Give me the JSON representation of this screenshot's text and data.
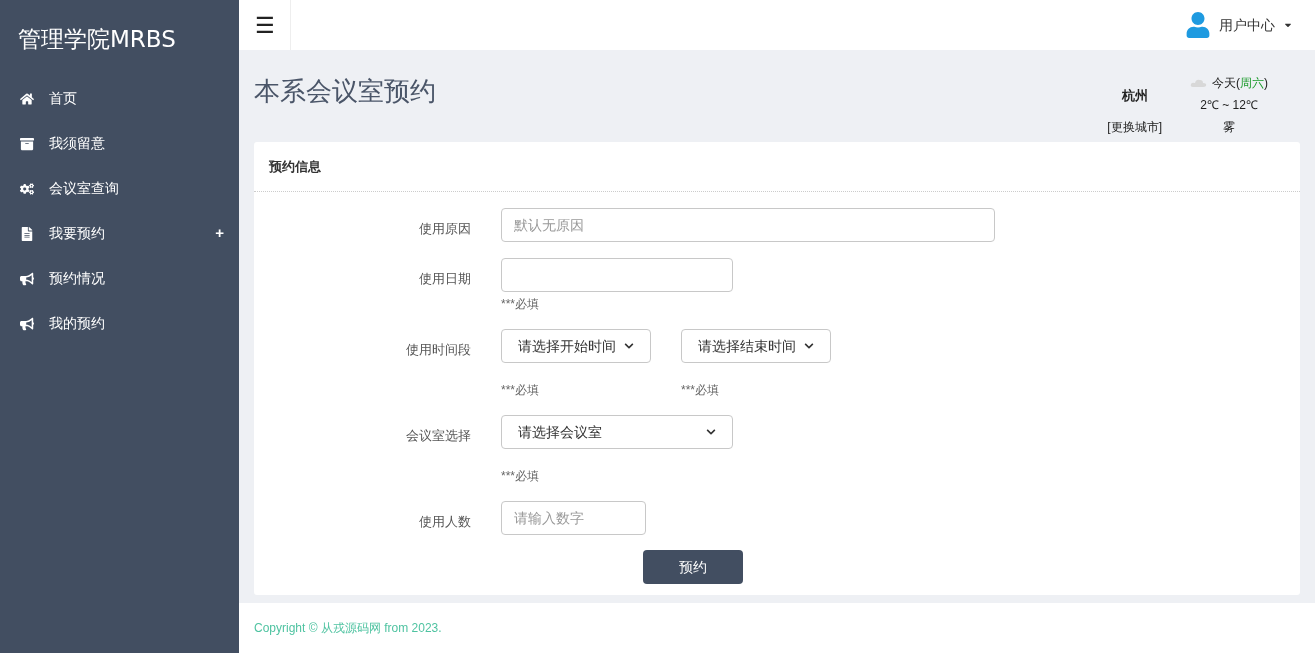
{
  "sidebar": {
    "title": "管理学院MRBS",
    "items": [
      {
        "label": "首页",
        "kind": "link"
      },
      {
        "label": "我须留意",
        "kind": "link"
      },
      {
        "label": "会议室查询",
        "kind": "link"
      },
      {
        "label": "我要预约",
        "kind": "submenu",
        "toggle": "+"
      },
      {
        "label": "预约情况",
        "kind": "link"
      },
      {
        "label": "我的预约",
        "kind": "link"
      }
    ]
  },
  "topbar": {
    "menu_toggle": "☰",
    "user_menu": "用户中心"
  },
  "page_title": "本系会议室预约",
  "weather": {
    "city": "杭州",
    "change_city": "[更换城市]",
    "day": "今天(",
    "weekday": "周六",
    "day_close": ")",
    "temperature": "2℃ ~ 12℃",
    "condition": "雾"
  },
  "card": {
    "title": "预约信息",
    "rows": [
      {
        "label": "使用原因",
        "kind": "input",
        "placeholder": "默认无原因"
      },
      {
        "label": "使用日期",
        "kind": "input",
        "hint": "***必填"
      },
      {
        "label": "使用时间段",
        "kind": "select_pair",
        "fields": [
          {
            "value": "请选择开始时间",
            "hint": "***必填"
          },
          {
            "value": "请选择结束时间",
            "hint": "***必填"
          }
        ]
      },
      {
        "label": "会议室选择",
        "kind": "select",
        "value": "请选择会议室",
        "hint": "***必填"
      },
      {
        "label": "使用人数",
        "kind": "input",
        "placeholder": "请输入数字"
      }
    ],
    "submit": "预约"
  },
  "footer": "Copyright © 从戎源码网 from 2023."
}
